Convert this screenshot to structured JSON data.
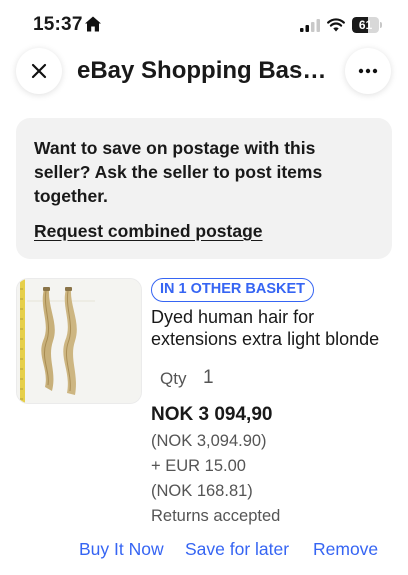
{
  "status_bar": {
    "time": "15:37",
    "battery_level": "61",
    "icons": [
      "home-icon",
      "signal-icon",
      "wifi-icon",
      "battery-icon"
    ]
  },
  "header": {
    "title": "eBay Shopping Basket",
    "close_icon": "close-icon",
    "more_icon": "more-icon"
  },
  "notice": {
    "message": "Want to save on postage with this seller? Ask the seller to post items together.",
    "link": "Request combined postage"
  },
  "item": {
    "badge": "IN 1 OTHER BASKET",
    "title_line1": "Dyed human hair for",
    "title_line2": "extensions extra light blonde",
    "quantity_label": "Qty",
    "quantity": "1",
    "price": "NOK 3 094,90",
    "price_converted": "(NOK 3,094.90)",
    "postage": "+ EUR 15.00",
    "postage_converted": "(NOK 168.81)",
    "returns": "Returns accepted"
  },
  "actions": {
    "buy_now": "Buy It Now",
    "save_for_later": "Save for later",
    "remove": "Remove"
  },
  "colors": {
    "accent": "#3665f3",
    "notice_bg": "#f2f2f2",
    "text": "#191919",
    "secondary_text": "#555555"
  }
}
